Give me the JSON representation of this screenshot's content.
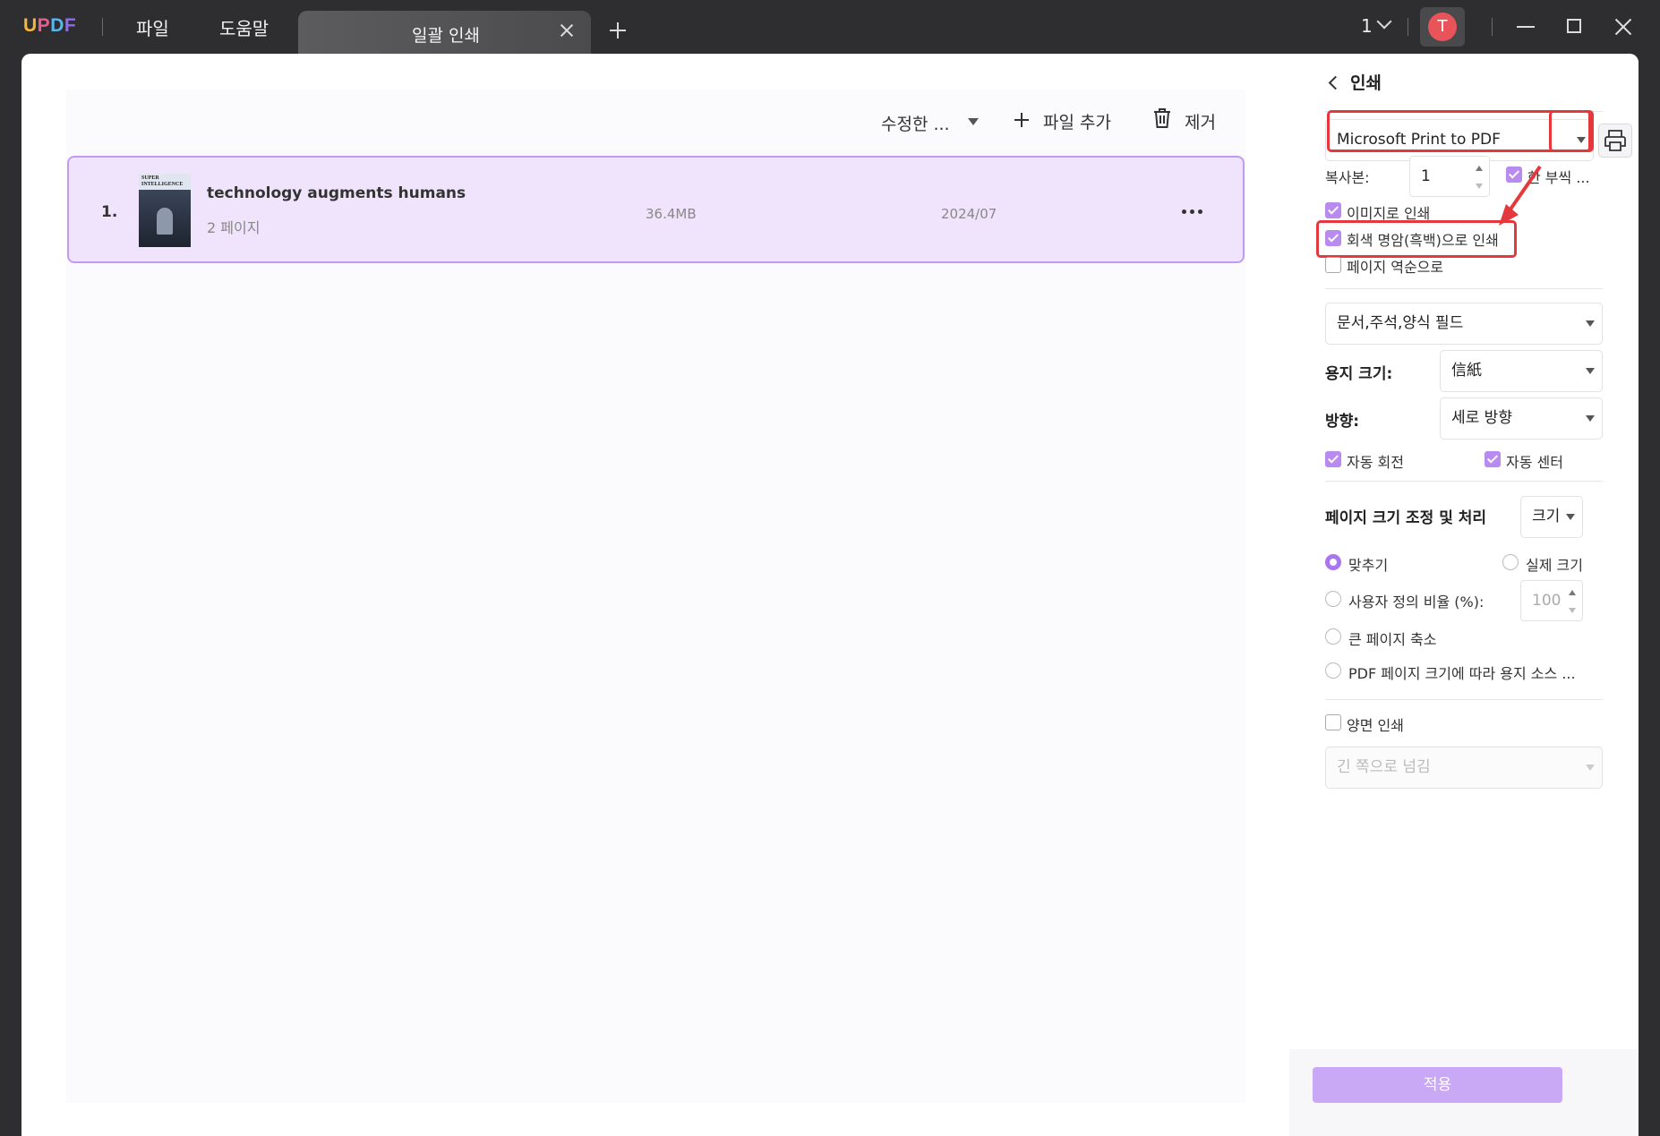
{
  "titlebar": {
    "logo": [
      "U",
      "P",
      "D",
      "F"
    ],
    "menus": [
      "파일",
      "도움말"
    ],
    "tab_label": "일괄 인쇄",
    "page_count": "1",
    "avatar_letter": "T"
  },
  "toolbar": {
    "sort_label": "수정한 ...",
    "add_file_label": "파일 추가",
    "remove_label": "제거"
  },
  "files": [
    {
      "index": "1.",
      "thumb_title": "SUPER INTELLIGENCE",
      "name": "technology augments humans",
      "pages": "2 페이지",
      "size": "36.4MB",
      "date": "2024/07"
    }
  ],
  "print_panel": {
    "title": "인쇄",
    "printer": "Microsoft Print to PDF",
    "copies_label": "복사본:",
    "copies_value": "1",
    "collate_label": "한 부씩 ...",
    "options": {
      "print_as_image": "이미지로 인쇄",
      "grayscale": "회색 명암(흑백)으로 인쇄",
      "reverse_pages": "페이지 역순으로"
    },
    "content_select": "문서,주석,양식 필드",
    "paper_size_label": "용지 크기:",
    "paper_size_value": "信紙",
    "orientation_label": "방향:",
    "orientation_value": "세로 방향",
    "auto_rotate": "자동 회전",
    "auto_center": "자동 센터",
    "scaling_label": "페이지 크기 조정 및 처리",
    "scaling_select": "크기",
    "fit": "맞추기",
    "actual_size": "실제 크기",
    "custom_scale": "사용자 정의 비율 (%):",
    "custom_scale_value": "100",
    "shrink_large": "큰 페이지 축소",
    "paper_source": "PDF 페이지 크기에 따라 용지 소스 ...",
    "duplex": "양면 인쇄",
    "flip_select": "긴 쪽으로 넘김",
    "apply_label": "적용"
  },
  "colors": {
    "accent": "#b98af0",
    "selection_bg": "#efe4fb",
    "highlight": "#e4383c"
  }
}
